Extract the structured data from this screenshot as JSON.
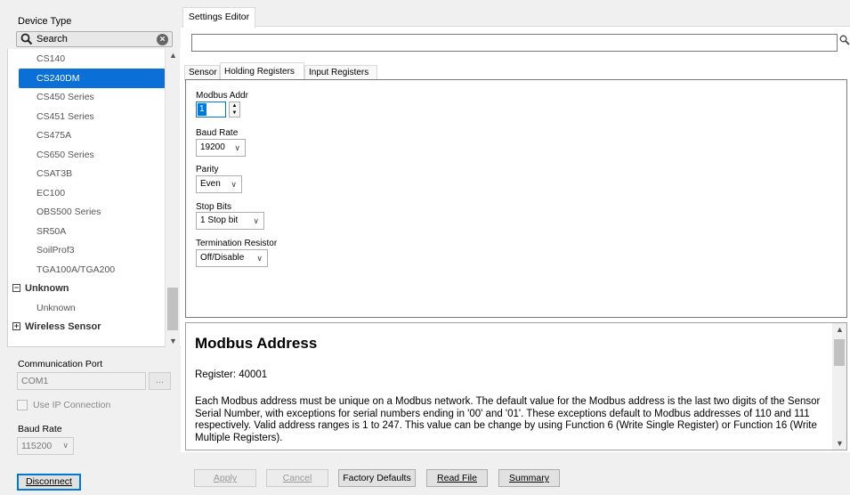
{
  "left": {
    "device_type_label": "Device Type",
    "search_placeholder": "Search",
    "tree": [
      {
        "label": "CS140",
        "type": "item"
      },
      {
        "label": "CS240DM",
        "type": "item",
        "selected": true
      },
      {
        "label": "CS450 Series",
        "type": "item"
      },
      {
        "label": "CS451 Series",
        "type": "item"
      },
      {
        "label": "CS475A",
        "type": "item"
      },
      {
        "label": "CS650 Series",
        "type": "item"
      },
      {
        "label": "CSAT3B",
        "type": "item"
      },
      {
        "label": "EC100",
        "type": "item"
      },
      {
        "label": "OBS500 Series",
        "type": "item"
      },
      {
        "label": "SR50A",
        "type": "item"
      },
      {
        "label": "SoilProf3",
        "type": "item"
      },
      {
        "label": "TGA100A/TGA200",
        "type": "item"
      },
      {
        "label": "Unknown",
        "type": "group",
        "toggle": "⊟"
      },
      {
        "label": "Unknown",
        "type": "item"
      },
      {
        "label": "Wireless Sensor",
        "type": "group",
        "toggle": "⊞"
      }
    ],
    "comm_port_label": "Communication Port",
    "comm_port_value": "COM1",
    "browse_label": "...",
    "use_ip_label": "Use IP Connection",
    "baud_rate_label": "Baud Rate",
    "baud_rate_value": "115200",
    "disconnect_label": "Disconnect"
  },
  "right": {
    "settings_tab": "Settings Editor",
    "filter_value": "",
    "subtabs": [
      "Sensor",
      "Holding Registers",
      "Input Registers"
    ],
    "active_subtab": "Holding Registers",
    "fields": {
      "modbus_addr_label": "Modbus Addr",
      "modbus_addr_value": "1",
      "baud_rate_label": "Baud Rate",
      "baud_rate_value": "19200",
      "parity_label": "Parity",
      "parity_value": "Even",
      "stop_bits_label": "Stop Bits",
      "stop_bits_value": "1 Stop bit",
      "termination_label": "Termination Resistor",
      "termination_value": "Off/Disable"
    },
    "help": {
      "title": "Modbus Address",
      "register": "Register: 40001",
      "description": "Each Modbus address must be unique on a Modbus network. The default value for the Modbus address is the last two digits of the Sensor Serial Number, with exceptions for serial numbers ending in '00' and '01'. These exceptions default to Modbus addresses of 110 and 111 respectively. Valid address ranges is 1 to 247. This value can be change by using Function 6 (Write Single Register) or Function 16 (Write Multiple Registers)."
    },
    "buttons": {
      "apply": "Apply",
      "cancel": "Cancel",
      "factory_defaults": "Factory Defaults",
      "read_file": "Read File",
      "summary": "Summary"
    }
  },
  "colors": {
    "selection": "#0a6fd6",
    "focus_border": "#0078d7"
  }
}
